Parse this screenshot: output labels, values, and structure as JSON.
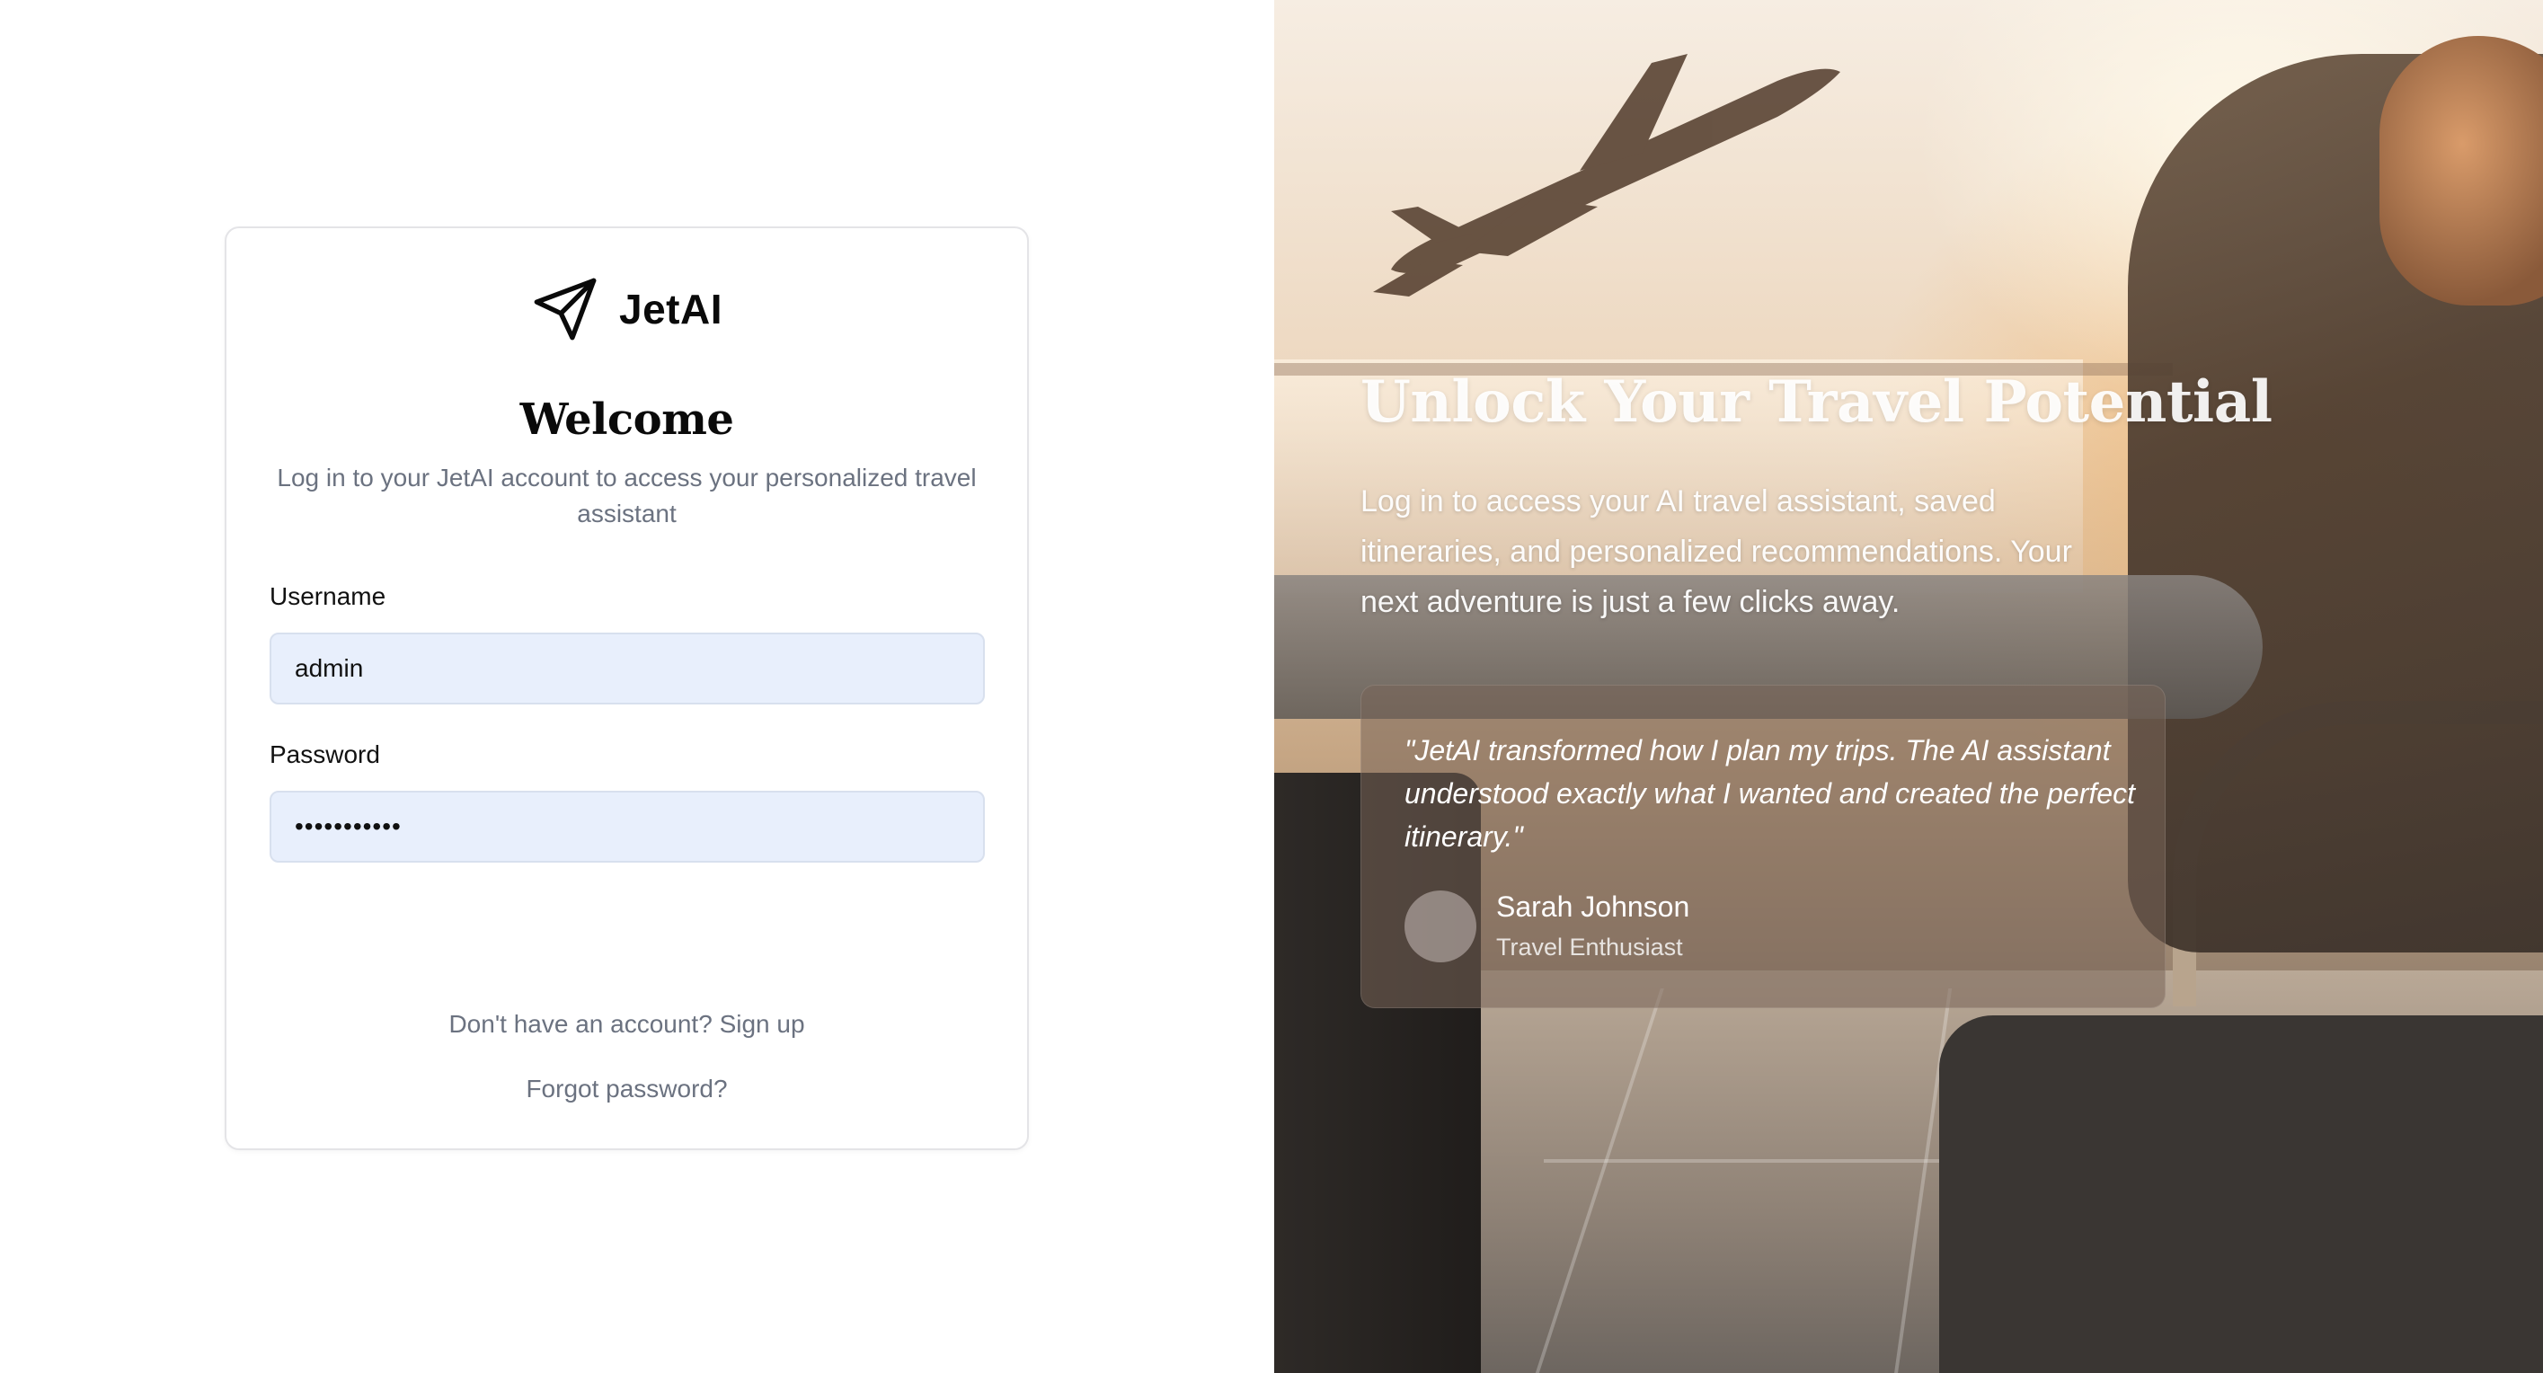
{
  "brand": {
    "name": "JetAI",
    "icon": "paper-plane-icon"
  },
  "login": {
    "title": "Welcome",
    "subtitle": "Log in to your JetAI account to access your personalized travel assistant",
    "username_label": "Username",
    "username_value": "admin",
    "password_label": "Password",
    "password_value": "•••••••••••",
    "signup_link": "Don't have an account? Sign up",
    "forgot_link": "Forgot password?"
  },
  "promo": {
    "title": "Unlock Your Travel Potential",
    "text": "Log in to access your AI travel assistant, saved itineraries, and personalized recommendations. Your next adventure is just a few clicks away.",
    "testimonial": {
      "quote": "\"JetAI transformed how I plan my trips. The AI assistant understood exactly what I wanted and created the perfect itinerary.\"",
      "author": "Sarah Johnson",
      "role": "Travel Enthusiast"
    }
  },
  "colors": {
    "input_bg": "#e8effc",
    "muted_text": "#6b7280",
    "card_border": "#e4e4e7"
  }
}
